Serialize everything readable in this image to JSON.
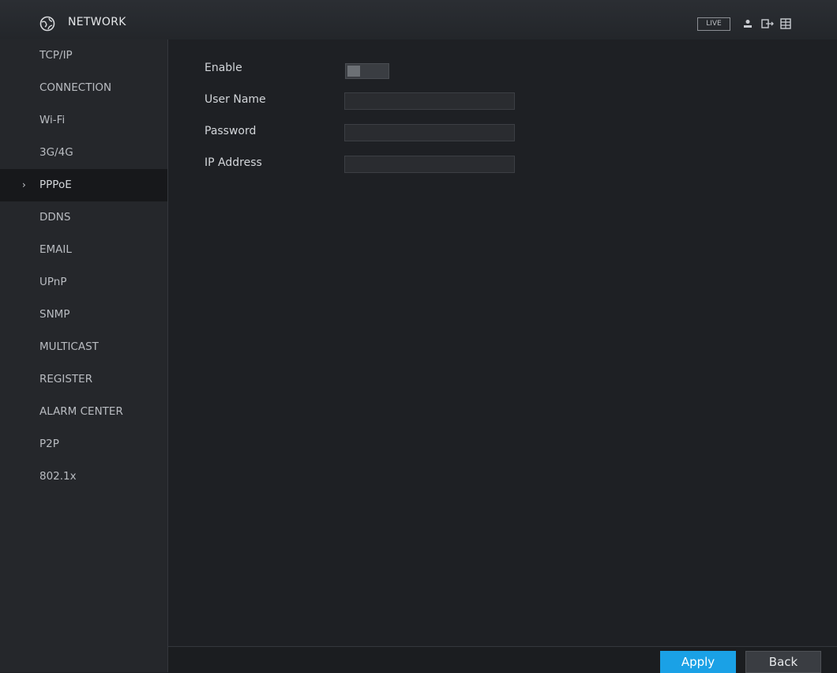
{
  "header": {
    "title": "NETWORK",
    "live_label": "LIVE",
    "icons": [
      "network-globe-icon",
      "user-icon",
      "logout-icon",
      "grid-icon"
    ]
  },
  "sidebar": {
    "items": [
      {
        "label": "TCP/IP"
      },
      {
        "label": "CONNECTION"
      },
      {
        "label": "Wi-Fi"
      },
      {
        "label": "3G/4G"
      },
      {
        "label": "PPPoE",
        "active": true
      },
      {
        "label": "DDNS"
      },
      {
        "label": "EMAIL"
      },
      {
        "label": "UPnP"
      },
      {
        "label": "SNMP"
      },
      {
        "label": "MULTICAST"
      },
      {
        "label": "REGISTER"
      },
      {
        "label": "ALARM CENTER"
      },
      {
        "label": "P2P"
      },
      {
        "label": "802.1x"
      }
    ],
    "active_marker": "›"
  },
  "form": {
    "enable_label": "Enable",
    "enable_value": false,
    "username_label": "User Name",
    "username_value": "",
    "password_label": "Password",
    "password_value": "",
    "ip_label": "IP Address",
    "ip_value": ""
  },
  "footer": {
    "apply_label": "Apply",
    "back_label": "Back"
  },
  "colors": {
    "accent": "#1aa1e6",
    "background": "#1e2024",
    "sidebar": "#25272b"
  }
}
